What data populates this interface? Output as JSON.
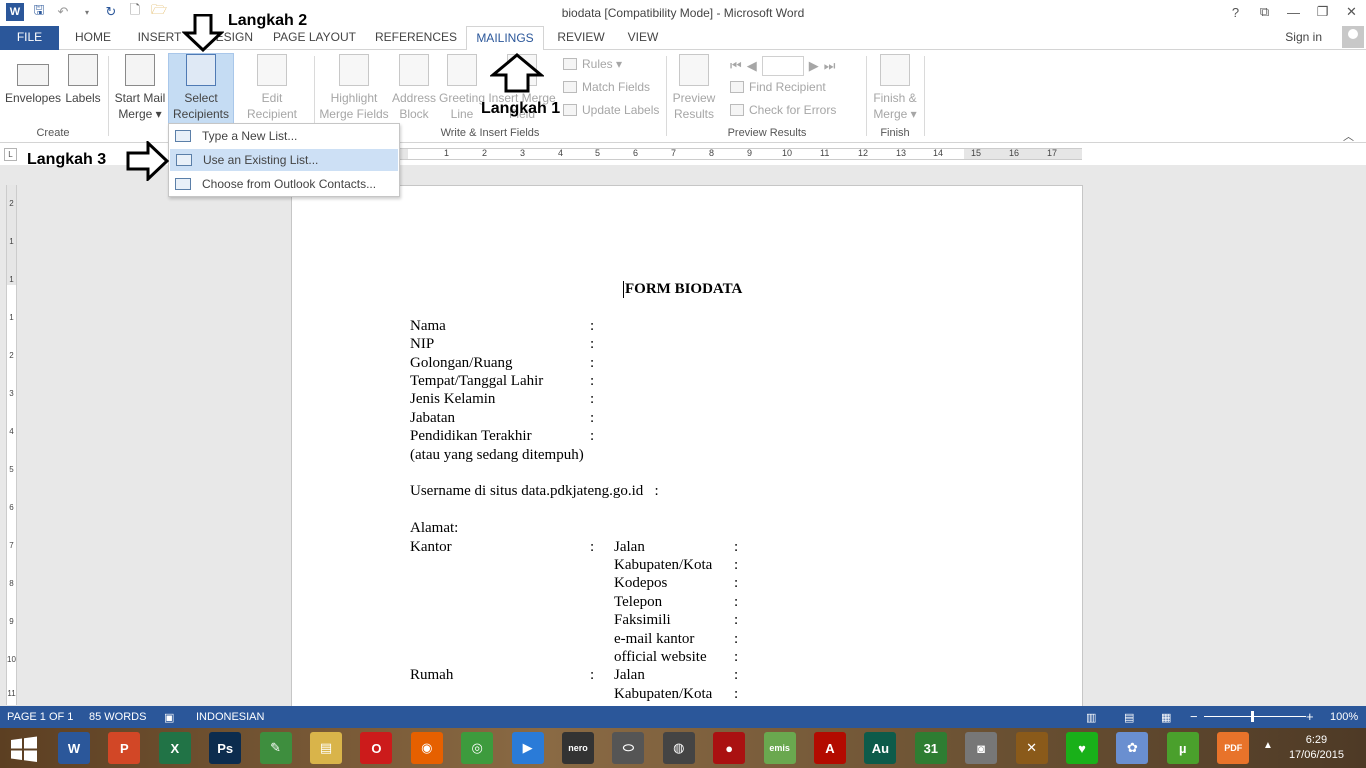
{
  "window": {
    "title": "biodata [Compatibility Mode] - Microsoft Word",
    "controls": [
      "?",
      "⧉",
      "—",
      "❐",
      "✕"
    ]
  },
  "qat": {
    "app_icon": "W"
  },
  "tabs": [
    {
      "label": "FILE"
    },
    {
      "label": "HOME"
    },
    {
      "label": "INSERT"
    },
    {
      "label": "DESIGN"
    },
    {
      "label": "PAGE LAYOUT"
    },
    {
      "label": "REFERENCES"
    },
    {
      "label": "MAILINGS"
    },
    {
      "label": "REVIEW"
    },
    {
      "label": "VIEW"
    }
  ],
  "active_tab": "MAILINGS",
  "signin": "Sign in",
  "ribbon": {
    "create": {
      "label": "Create",
      "envelopes": "Envelopes",
      "labels": "Labels"
    },
    "start_mail_merge": {
      "label": "Start Mail Merge",
      "start_line1": "Start Mail",
      "start_line2": "Merge ▾",
      "select_line1": "Select",
      "select_line2": "Recipients ▾",
      "edit_line1": "Edit",
      "edit_line2": "Recipient List"
    },
    "write_insert": {
      "label": "Write & Insert Fields",
      "highlight_line1": "Highlight",
      "highlight_line2": "Merge Fields",
      "address_line1": "Address",
      "address_line2": "Block",
      "greeting_line1": "Greeting",
      "greeting_line2": "Line",
      "insert_line1": "Insert Merge",
      "insert_line2": "Field",
      "rules": "Rules ▾",
      "match_fields": "Match Fields",
      "update_labels": "Update Labels"
    },
    "preview": {
      "label": "Preview Results",
      "preview_line1": "Preview",
      "preview_line2": "Results",
      "find_recipient": "Find Recipient",
      "check_errors": "Check for Errors"
    },
    "finish": {
      "label": "Finish",
      "finish_line1": "Finish &",
      "finish_line2": "Merge ▾"
    }
  },
  "dropdown": {
    "items": [
      {
        "label": "Type a New List..."
      },
      {
        "label": "Use an Existing List..."
      },
      {
        "label": "Choose from Outlook Contacts..."
      }
    ],
    "highlighted_index": 1
  },
  "annotations": {
    "step1": "Langkah 1",
    "step2": "Langkah 2",
    "step3": "Langkah 3"
  },
  "ruler": {
    "h_labels": [
      "2",
      "1",
      "1",
      "2",
      "3",
      "4",
      "5",
      "6",
      "7",
      "8",
      "9",
      "10",
      "11",
      "12",
      "13",
      "14",
      "15",
      "16",
      "17"
    ],
    "v_labels": [
      "2",
      "1",
      "1",
      "1",
      "2",
      "3",
      "4",
      "5",
      "6",
      "7",
      "8",
      "9",
      "10",
      "11"
    ]
  },
  "document": {
    "title": "FORM BIODATA",
    "fields": [
      "Nama",
      "NIP",
      "Golongan/Ruang",
      "Tempat/Tanggal Lahir",
      "Jenis Kelamin",
      "Jabatan",
      "Pendidikan Terakhir"
    ],
    "note": "(atau yang sedang ditempuh)",
    "username": "Username di situs data.pdkjateng.go.id   :",
    "alamat": "Alamat:",
    "kantor": "Kantor",
    "kantor_fields": [
      "Jalan",
      "Kabupaten/Kota",
      "Kodepos",
      "Telepon",
      "Faksimili",
      "e-mail kantor",
      "official website"
    ],
    "rumah": "Rumah",
    "rumah_fields": [
      "Jalan",
      "Kabupaten/Kota"
    ],
    "colon": ":"
  },
  "status": {
    "page": "PAGE 1 OF 1",
    "words": "85 WORDS",
    "language": "INDONESIAN",
    "zoom": "100%",
    "zoom_minus": "−",
    "zoom_plus": "+"
  },
  "taskbar": {
    "apps": [
      {
        "name": "word",
        "glyph": "W",
        "color": "#2b579a"
      },
      {
        "name": "powerpoint",
        "glyph": "P",
        "color": "#d24726"
      },
      {
        "name": "excel",
        "glyph": "X",
        "color": "#217346"
      },
      {
        "name": "photoshop",
        "glyph": "Ps",
        "color": "#0c2c4e"
      },
      {
        "name": "coreldraw",
        "glyph": "✎",
        "color": "#3e8e3e"
      },
      {
        "name": "explorer",
        "glyph": "▤",
        "color": "#d9b44a"
      },
      {
        "name": "opera",
        "glyph": "O",
        "color": "#cc1b1b"
      },
      {
        "name": "firefox",
        "glyph": "◉",
        "color": "#e66000"
      },
      {
        "name": "chrome",
        "glyph": "◎",
        "color": "#3d9b3d"
      },
      {
        "name": "media-player",
        "glyph": "▶",
        "color": "#2a7bd8"
      },
      {
        "name": "nero",
        "glyph": "nero",
        "color": "#333333"
      },
      {
        "name": "nero-galaxy",
        "glyph": "⬭",
        "color": "#555555"
      },
      {
        "name": "camera",
        "glyph": "◍",
        "color": "#444444"
      },
      {
        "name": "recorder",
        "glyph": "●",
        "color": "#aa1111"
      },
      {
        "name": "emis",
        "glyph": "emis",
        "color": "#6aa84f"
      },
      {
        "name": "acrobat",
        "glyph": "A",
        "color": "#b30b00"
      },
      {
        "name": "audition",
        "glyph": "Au",
        "color": "#0d5b4a"
      },
      {
        "name": "calendar",
        "glyph": "31",
        "color": "#2e7d32"
      },
      {
        "name": "recorder2",
        "glyph": "◙",
        "color": "#777777"
      },
      {
        "name": "tools",
        "glyph": "✕",
        "color": "#8a5a1a"
      },
      {
        "name": "heart",
        "glyph": "♥",
        "color": "#19b019"
      },
      {
        "name": "paint",
        "glyph": "✿",
        "color": "#6a8fd0"
      },
      {
        "name": "utorrent",
        "glyph": "µ",
        "color": "#4aa02c"
      },
      {
        "name": "pdf",
        "glyph": "PDF",
        "color": "#e8732a"
      }
    ],
    "tray_arrow": "▲",
    "time": "6:29",
    "date": "17/06/2015"
  }
}
